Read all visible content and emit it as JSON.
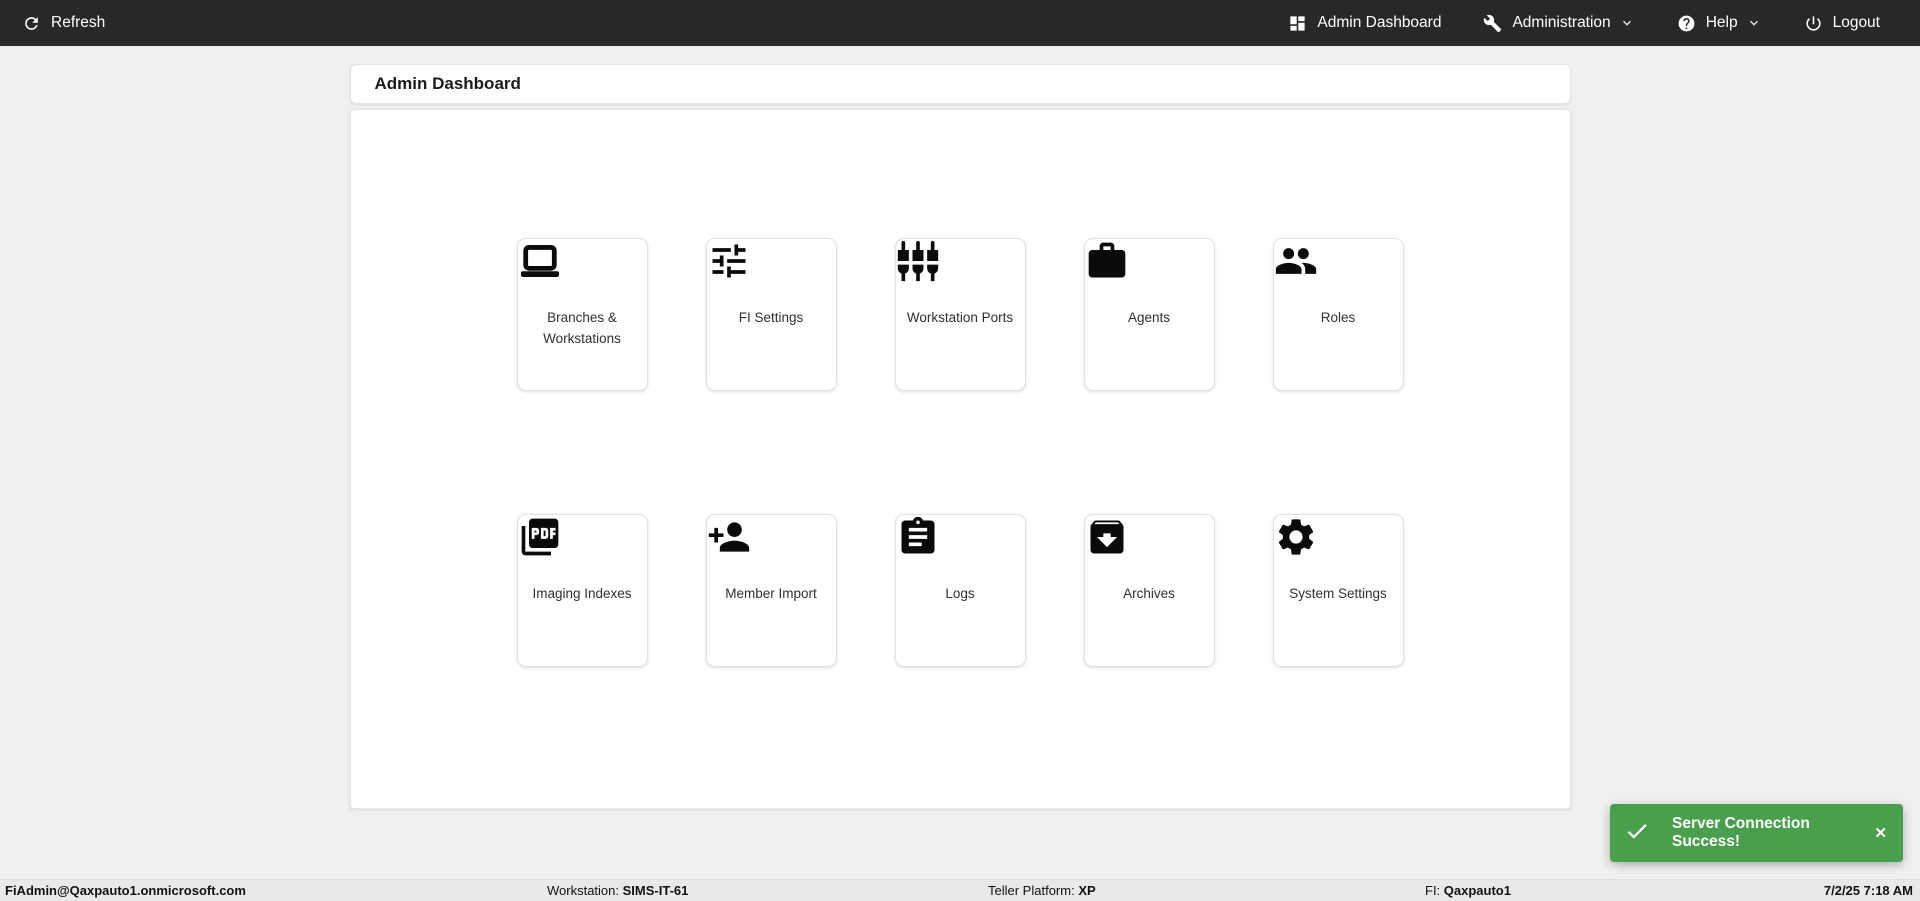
{
  "topbar": {
    "refresh_label": "Refresh",
    "nav": [
      {
        "label": "Admin Dashboard",
        "icon": "dashboard-icon",
        "has_chevron": false
      },
      {
        "label": "Administration",
        "icon": "wrench-icon",
        "has_chevron": true
      },
      {
        "label": "Help",
        "icon": "help-icon",
        "has_chevron": true
      },
      {
        "label": "Logout",
        "icon": "power-icon",
        "has_chevron": false
      }
    ]
  },
  "page": {
    "title": "Admin Dashboard"
  },
  "tiles": [
    {
      "label": "Branches & Workstations",
      "icon": "laptop-icon"
    },
    {
      "label": "FI Settings",
      "icon": "tune-icon"
    },
    {
      "label": "Workstation Ports",
      "icon": "input-component-icon"
    },
    {
      "label": "Agents",
      "icon": "briefcase-icon"
    },
    {
      "label": "Roles",
      "icon": "people-icon"
    },
    {
      "label": "Imaging Indexes",
      "icon": "pdf-icon"
    },
    {
      "label": "Member Import",
      "icon": "person-add-icon"
    },
    {
      "label": "Logs",
      "icon": "clipboard-icon"
    },
    {
      "label": "Archives",
      "icon": "archive-icon"
    },
    {
      "label": "System Settings",
      "icon": "gear-icon"
    }
  ],
  "toast": {
    "message": "Server Connection Success!",
    "close_label": "✕",
    "icon": "check-icon",
    "color": "#4a9f4d"
  },
  "statusbar": {
    "user": "FiAdmin@Qaxpauto1.onmicrosoft.com",
    "workstation_label": "Workstation:",
    "workstation": "SIMS-IT-61",
    "teller_platform_label": "Teller Platform:",
    "teller_platform": "XP",
    "fi_label": "FI:",
    "fi": "Qaxpauto1",
    "datetime": "7/2/25 7:18 AM"
  },
  "colors": {
    "topbar_bg": "#282828",
    "page_bg": "#f0f0f0",
    "statusbar_bg": "#e9e9e9",
    "toast_green": "#4a9f4d",
    "icon_black": "#0a0a0a"
  }
}
